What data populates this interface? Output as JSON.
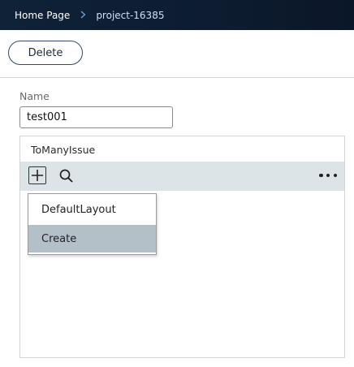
{
  "breadcrumb": {
    "home": "Home Page",
    "separator": ">",
    "current": "project-16385"
  },
  "toolbar": {
    "delete_label": "Delete"
  },
  "form": {
    "name_label": "Name",
    "name_value": "test001"
  },
  "panel": {
    "title": "ToManyIssue",
    "icons": {
      "add": "plus-icon",
      "search": "search-icon",
      "more": "more-horizontal-icon"
    }
  },
  "dropdown_menu": {
    "items": [
      {
        "label": "DefaultLayout",
        "highlighted": false
      },
      {
        "label": "Create",
        "highlighted": true
      }
    ],
    "highlight_color": "#b4c0c8"
  },
  "colors": {
    "topbar": "#0f2238",
    "breadcrumb_separator": "#7aa7d6",
    "toolbar_bg": "#dde4e8",
    "button_border": "#2f4a68"
  }
}
